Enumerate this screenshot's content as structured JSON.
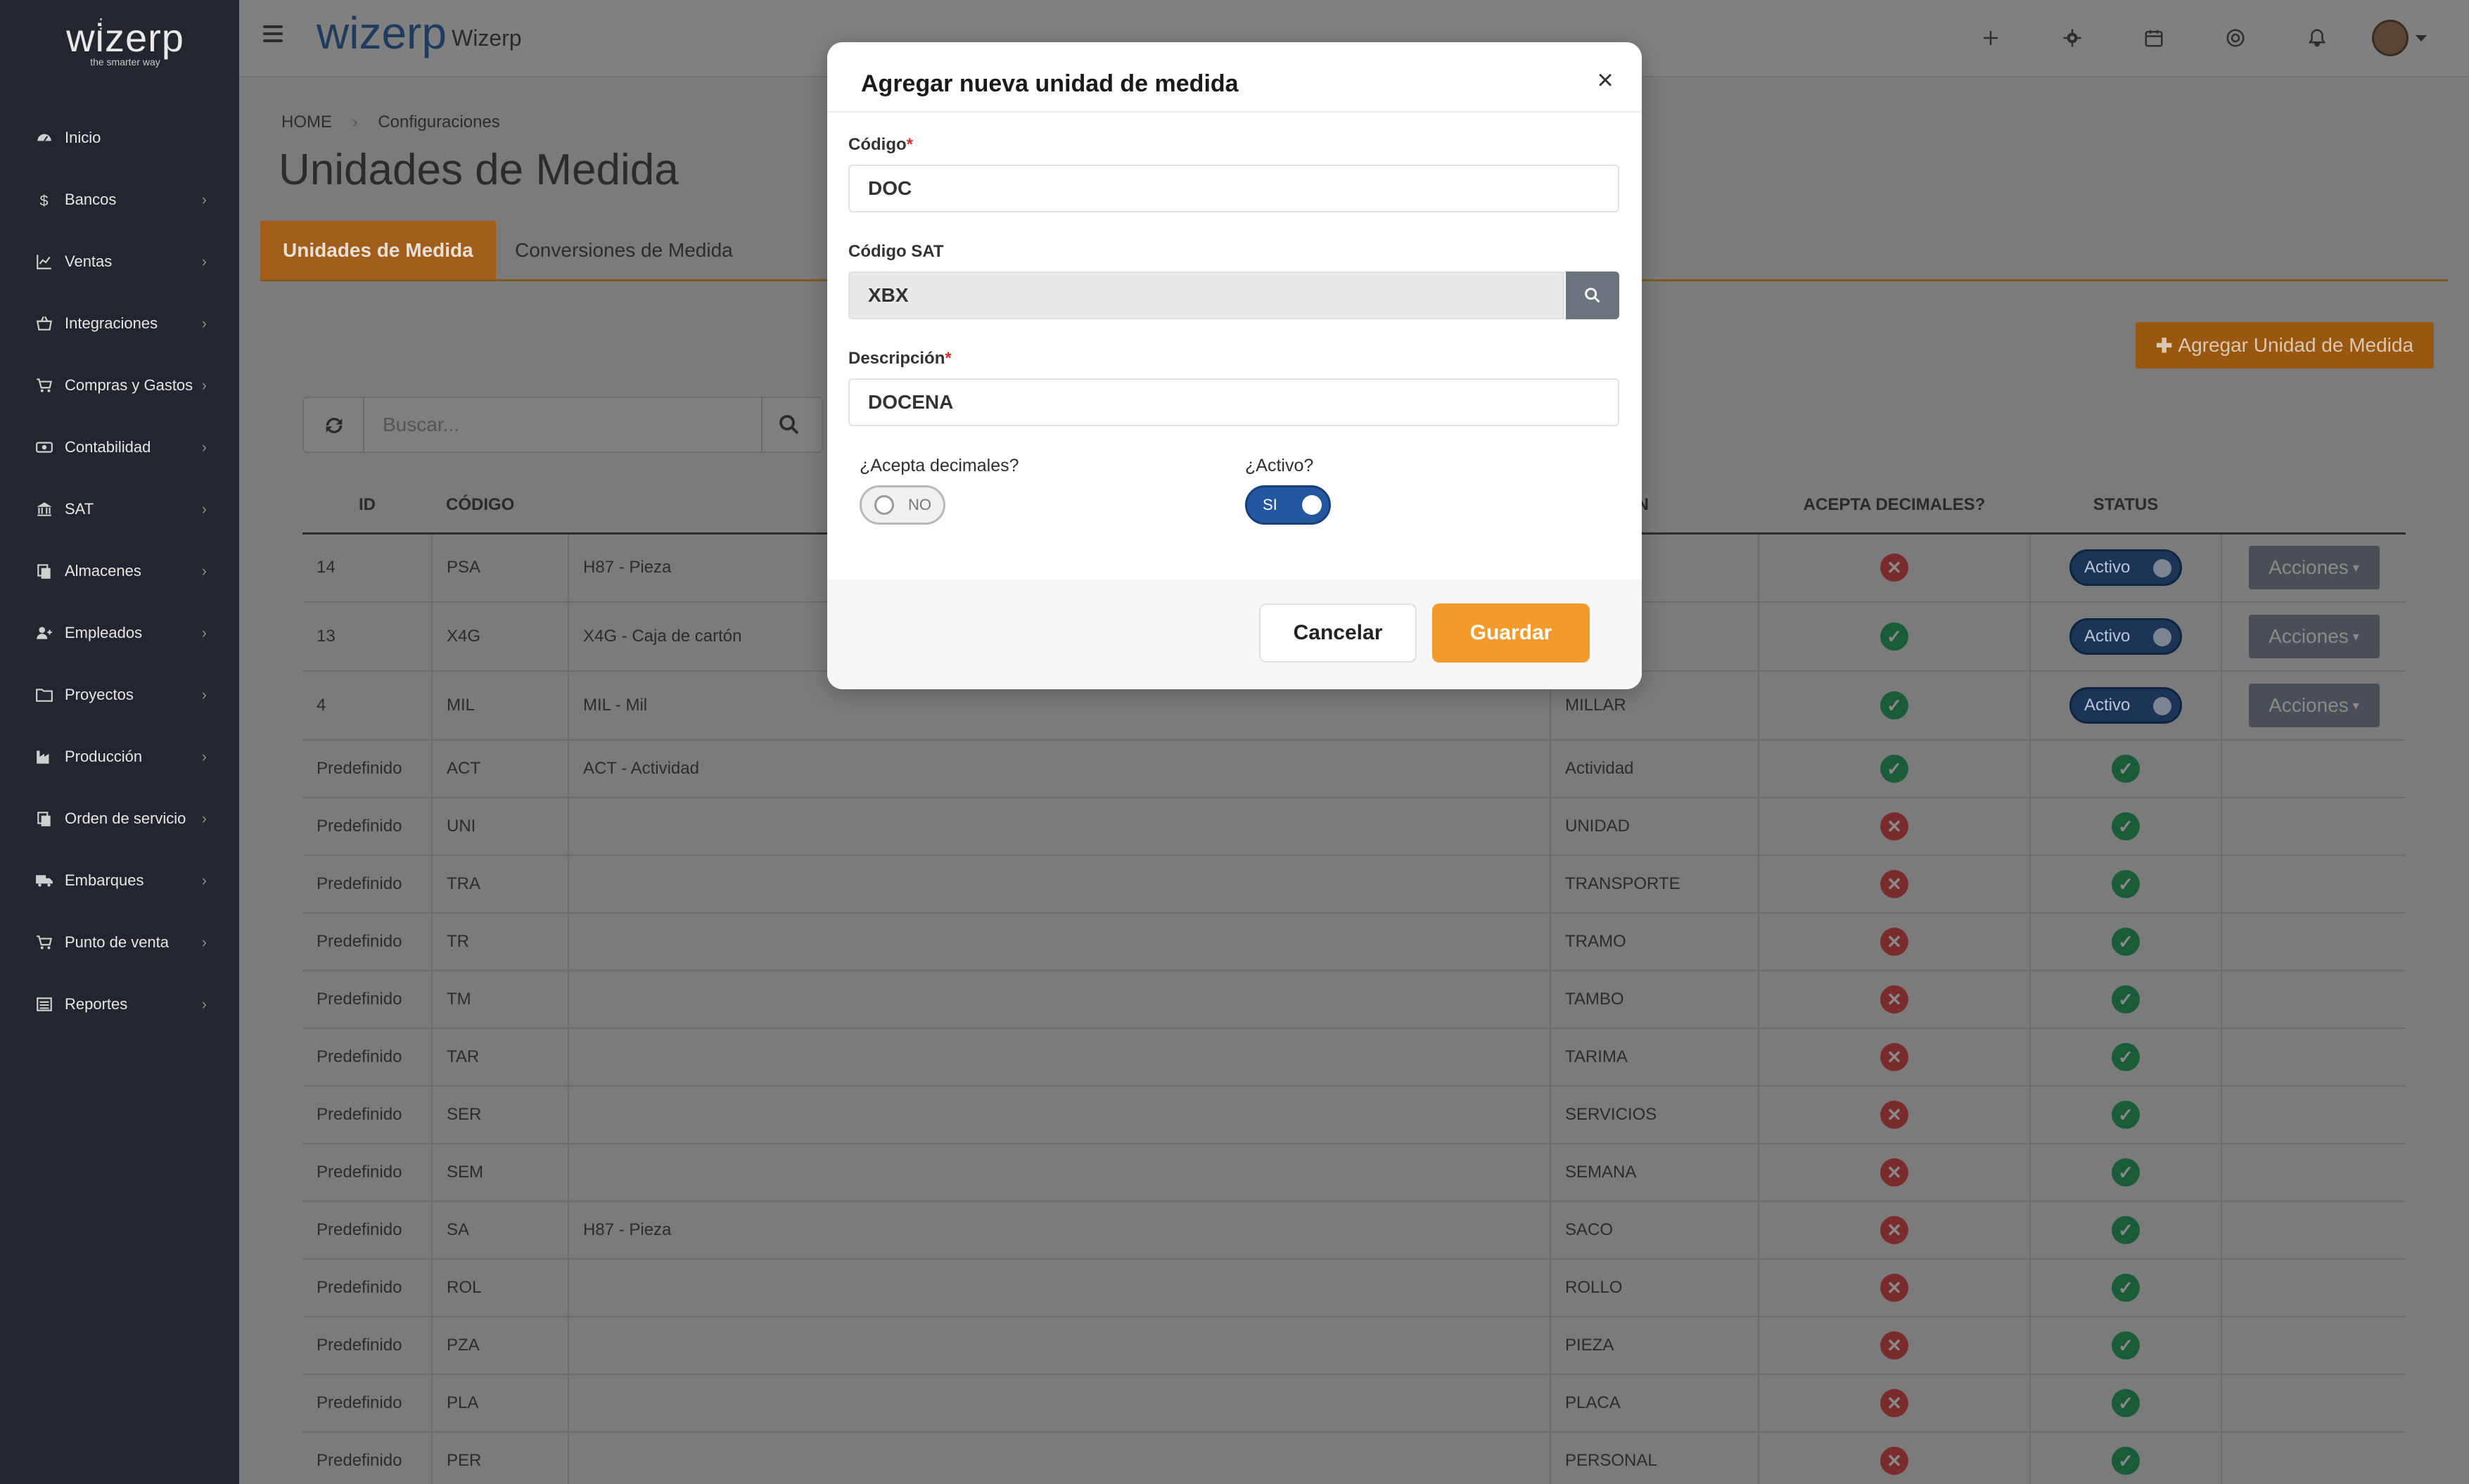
{
  "brand": {
    "name": "wizerp",
    "tagline": "the smarter way"
  },
  "sidebar": {
    "items": [
      {
        "label": "Inicio",
        "icon": "dashboard-icon",
        "expandable": false
      },
      {
        "label": "Bancos",
        "icon": "dollar-icon",
        "expandable": true
      },
      {
        "label": "Ventas",
        "icon": "chart-line-icon",
        "expandable": true
      },
      {
        "label": "Integraciones",
        "icon": "basket-icon",
        "expandable": true
      },
      {
        "label": "Compras y Gastos",
        "icon": "cart-icon",
        "expandable": true
      },
      {
        "label": "Contabilidad",
        "icon": "money-icon",
        "expandable": true
      },
      {
        "label": "SAT",
        "icon": "bank-icon",
        "expandable": true
      },
      {
        "label": "Almacenes",
        "icon": "copy-icon",
        "expandable": true
      },
      {
        "label": "Empleados",
        "icon": "user-plus-icon",
        "expandable": true
      },
      {
        "label": "Proyectos",
        "icon": "folder-icon",
        "expandable": true
      },
      {
        "label": "Producción",
        "icon": "industry-icon",
        "expandable": true
      },
      {
        "label": "Orden de servicio",
        "icon": "copy-icon",
        "expandable": true
      },
      {
        "label": "Embarques",
        "icon": "truck-icon",
        "expandable": true
      },
      {
        "label": "Punto de venta",
        "icon": "cart-icon",
        "expandable": true
      },
      {
        "label": "Reportes",
        "icon": "list-icon",
        "expandable": true
      }
    ]
  },
  "topbar": {
    "app_title": "Wizerp"
  },
  "breadcrumb": {
    "home": "HOME",
    "current": "Configuraciones"
  },
  "page": {
    "title": "Unidades de Medida",
    "tabs": [
      {
        "label": "Unidades de Medida",
        "active": true
      },
      {
        "label": "Conversiones de Medida",
        "active": false
      }
    ],
    "add_button": "Agregar Unidad de Medida",
    "search_placeholder": "Buscar..."
  },
  "table": {
    "headers": {
      "id": "ID",
      "code": "CÓDIGO",
      "sat": "",
      "desc": "RIPCIÓN",
      "decimals": "ACEPTA DECIMALES?",
      "status": "STATUS",
      "actions": ""
    },
    "status_label": "Activo",
    "actions_label": "Acciones",
    "rows": [
      {
        "id": "14",
        "code": "PSA",
        "sat": "H87 - Pieza",
        "desc": "",
        "decimals": false,
        "status": "pill"
      },
      {
        "id": "13",
        "code": "X4G",
        "sat": "X4G - Caja de cartón",
        "desc": "",
        "decimals": true,
        "status": "pill"
      },
      {
        "id": "4",
        "code": "MIL",
        "sat": "MIL - Mil",
        "desc": "MILLAR",
        "decimals": true,
        "status": "pill"
      },
      {
        "id": "Predefinido",
        "code": "ACT",
        "sat": "ACT - Actividad",
        "desc": "Actividad",
        "decimals": true,
        "status": "check"
      },
      {
        "id": "Predefinido",
        "code": "UNI",
        "sat": "",
        "desc": "UNIDAD",
        "decimals": false,
        "status": "check"
      },
      {
        "id": "Predefinido",
        "code": "TRA",
        "sat": "",
        "desc": "TRANSPORTE",
        "decimals": false,
        "status": "check"
      },
      {
        "id": "Predefinido",
        "code": "TR",
        "sat": "",
        "desc": "TRAMO",
        "decimals": false,
        "status": "check"
      },
      {
        "id": "Predefinido",
        "code": "TM",
        "sat": "",
        "desc": "TAMBO",
        "decimals": false,
        "status": "check"
      },
      {
        "id": "Predefinido",
        "code": "TAR",
        "sat": "",
        "desc": "TARIMA",
        "decimals": false,
        "status": "check"
      },
      {
        "id": "Predefinido",
        "code": "SER",
        "sat": "",
        "desc": "SERVICIOS",
        "decimals": false,
        "status": "check"
      },
      {
        "id": "Predefinido",
        "code": "SEM",
        "sat": "",
        "desc": "SEMANA",
        "decimals": false,
        "status": "check"
      },
      {
        "id": "Predefinido",
        "code": "SA",
        "sat": "H87 - Pieza",
        "desc": "SACO",
        "decimals": false,
        "status": "check"
      },
      {
        "id": "Predefinido",
        "code": "ROL",
        "sat": "",
        "desc": "ROLLO",
        "decimals": false,
        "status": "check"
      },
      {
        "id": "Predefinido",
        "code": "PZA",
        "sat": "",
        "desc": "PIEZA",
        "decimals": false,
        "status": "check"
      },
      {
        "id": "Predefinido",
        "code": "PLA",
        "sat": "",
        "desc": "PLACA",
        "decimals": false,
        "status": "check"
      },
      {
        "id": "Predefinido",
        "code": "PER",
        "sat": "",
        "desc": "PERSONAL",
        "decimals": false,
        "status": "check"
      }
    ]
  },
  "modal": {
    "title": "Agregar nueva unidad de medida",
    "code_label": "Código",
    "code_value": "DOC",
    "sat_label": "Código SAT",
    "sat_value": "XBX",
    "desc_label": "Descripción",
    "desc_value": "DOCENA",
    "required_mark": "*",
    "decimals_label": "¿Acepta decimales?",
    "decimals_toggle": "NO",
    "active_label": "¿Activo?",
    "active_toggle": "SI",
    "cancel_label": "Cancelar",
    "save_label": "Guardar"
  },
  "colors": {
    "accent": "#f29b2c",
    "primary": "#2457a0",
    "sidebar": "#23262c"
  }
}
